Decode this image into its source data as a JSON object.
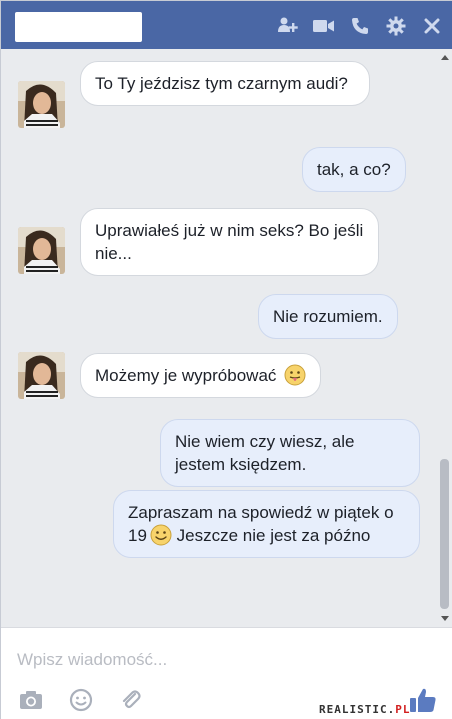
{
  "header": {
    "icons": [
      "add-friend-icon",
      "video-call-icon",
      "phone-icon",
      "gear-icon",
      "close-icon"
    ],
    "bg_color": "#4a67a5"
  },
  "messages": [
    {
      "side": "in",
      "text": "To Ty jeździsz tym czarnym audi?"
    },
    {
      "side": "out",
      "text": "tak, a co?"
    },
    {
      "side": "in",
      "text": "Uprawiałeś już w nim seks? Bo jeśli nie..."
    },
    {
      "side": "out",
      "text": "Nie rozumiem."
    },
    {
      "side": "in",
      "text": "Możemy je wypróbować",
      "emoji": "tongue-face-emoji"
    },
    {
      "side": "out",
      "text": "Nie wiem czy wiesz, ale jestem księdzem."
    },
    {
      "side": "out",
      "text_before": "Zapraszam na spowiedź w piątek o 19",
      "emoji": "smile-emoji",
      "text_after": "Jeszcze nie jest za późno"
    }
  ],
  "composer": {
    "placeholder": "Wpisz wiadomość...",
    "tools": [
      "camera-icon",
      "emoji-icon",
      "attachment-icon"
    ],
    "like_icon": "thumbs-up-icon"
  },
  "watermark": {
    "main": "REALISTIC.",
    "suffix": "PL"
  }
}
